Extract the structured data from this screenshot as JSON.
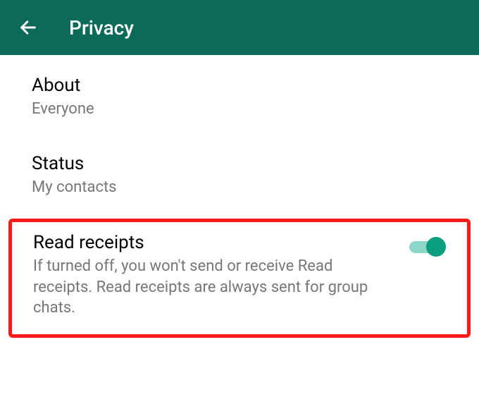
{
  "header": {
    "title": "Privacy"
  },
  "settings": {
    "about": {
      "title": "About",
      "value": "Everyone"
    },
    "status": {
      "title": "Status",
      "value": "My contacts"
    },
    "readReceipts": {
      "title": "Read receipts",
      "description": "If turned off, you won't send or receive Read receipts. Read receipts are always sent for group chats.",
      "enabled": true
    }
  }
}
